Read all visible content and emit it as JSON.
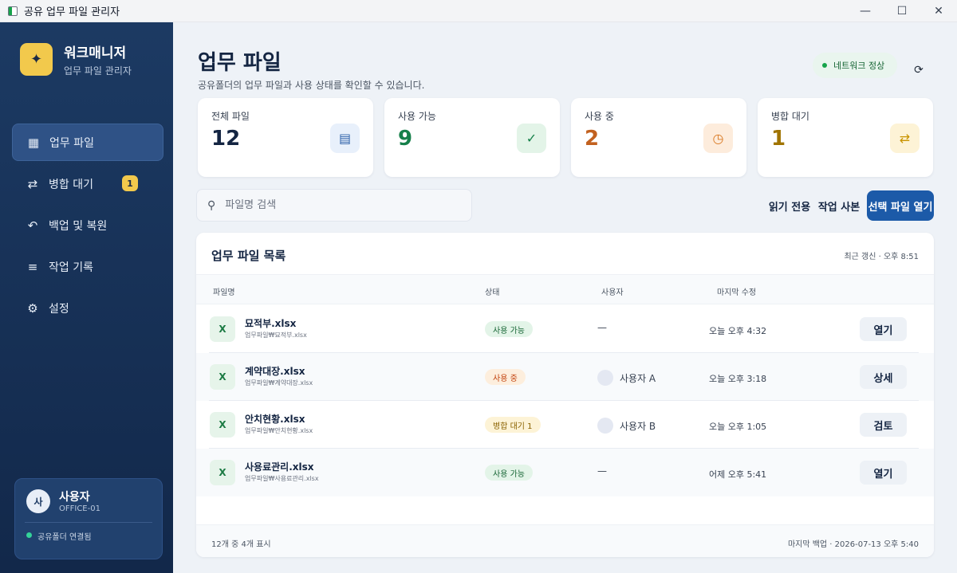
{
  "window": {
    "title": "공유 업무 파일 관리자",
    "minimize": "—",
    "maximize": "☐",
    "close": "✕"
  },
  "sidebar": {
    "brand_icon": "✦",
    "brand_name": "워크매니저",
    "brand_sub": "업무 파일 관리자",
    "items": [
      {
        "label": "업무 파일",
        "icon": "▦",
        "icon_name": "grid-icon",
        "active": true
      },
      {
        "label": "병합 대기",
        "icon": "⇄",
        "icon_name": "swap-icon",
        "badge": "1"
      },
      {
        "label": "백업 및 복원",
        "icon": "↶",
        "icon_name": "undo-icon"
      },
      {
        "label": "작업 기록",
        "icon": "≡",
        "icon_name": "list-icon"
      },
      {
        "label": "설정",
        "icon": "⚙",
        "icon_name": "gear-icon"
      }
    ],
    "user": {
      "avatar": "사",
      "name": "사용자",
      "id": "OFFICE-01",
      "connection": "공유폴더 연결됨"
    }
  },
  "header": {
    "title": "업무 파일",
    "subtitle": "공유폴더의 업무 파일과 사용 상태를 확인할 수 있습니다.",
    "network_status": "네트워크 정상",
    "refresh_icon": "⟳"
  },
  "stats": [
    {
      "label": "전체 파일",
      "value": "12",
      "icon": "▤",
      "value_color": "#142542",
      "icon_bg": "#e8f0fb",
      "icon_color": "#2b5fa8"
    },
    {
      "label": "사용 가능",
      "value": "9",
      "icon": "✓",
      "value_color": "#16804a",
      "icon_bg": "#e3f4e8",
      "icon_color": "#16804a"
    },
    {
      "label": "사용 중",
      "value": "2",
      "icon": "◷",
      "value_color": "#c2611f",
      "icon_bg": "#fdecdc",
      "icon_color": "#d9771f"
    },
    {
      "label": "병합 대기",
      "value": "1",
      "icon": "⇄",
      "value_color": "#a07400",
      "icon_bg": "#fdf3d6",
      "icon_color": "#c99400"
    }
  ],
  "toolbar": {
    "search_placeholder": "파일명 검색",
    "search_icon": "⚲",
    "read_only": "읽기 전용",
    "work_copy": "작업 사본",
    "open_selected": "선택 파일 열기"
  },
  "table": {
    "title": "업무 파일 목록",
    "refresh_time": "최근 갱신 · 오후 8:51",
    "columns": [
      "파일명",
      "상태",
      "사용자",
      "마지막 수정"
    ],
    "rows": [
      {
        "icon": "X",
        "name": "묘적부.xlsx",
        "path": "업무파일₩묘적부.xlsx",
        "status": "사용 가능",
        "status_type": "avail",
        "user": "—",
        "has_user": false,
        "modified": "오늘  오후 4:32",
        "action": "열기"
      },
      {
        "icon": "X",
        "name": "계약대장.xlsx",
        "path": "업무파일₩계약대장.xlsx",
        "status": "사용 중",
        "status_type": "inuse",
        "user": "사용자 A",
        "has_user": true,
        "modified": "오늘  오후 3:18",
        "action": "상세"
      },
      {
        "icon": "X",
        "name": "안치현황.xlsx",
        "path": "업무파일₩안치현황.xlsx",
        "status": "병합 대기 1",
        "status_type": "merge",
        "user": "사용자 B",
        "has_user": true,
        "modified": "오늘  오후 1:05",
        "action": "검토"
      },
      {
        "icon": "X",
        "name": "사용료관리.xlsx",
        "path": "업무파일₩사용료관리.xlsx",
        "status": "사용 가능",
        "status_type": "avail",
        "user": "—",
        "has_user": false,
        "modified": "어제  오후 5:41",
        "action": "열기"
      }
    ],
    "footer_left": "12개 중 4개 표시",
    "footer_right": "마지막 백업 · 2026-07-13 오후 5:40"
  }
}
